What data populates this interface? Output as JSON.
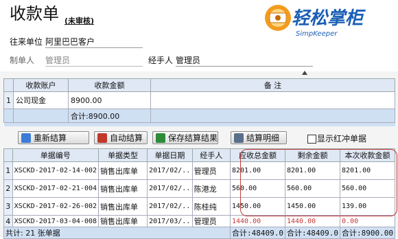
{
  "title": "收款单",
  "status": "(未审核)",
  "brand": {
    "name": "轻松掌柜",
    "sub": "SimpKeeper"
  },
  "form": {
    "partner_label": "往来单位",
    "partner_value": "阿里巴巴客户",
    "maker_label": "制单人",
    "maker_value": "管理员",
    "handler_label": "经手人",
    "handler_value": "管理员"
  },
  "account_table": {
    "headers": [
      "",
      "收款账户",
      "收款金额",
      "备 注"
    ],
    "rows": [
      {
        "idx": "1",
        "account": "公司现金",
        "amount": "8900.00",
        "note": ""
      }
    ],
    "total": "合计:8900.00"
  },
  "toolbar": {
    "recalc": "重新结算",
    "auto": "自动结算",
    "save": "保存结算结果",
    "detail": "结算明细",
    "red_label": "显示红冲单据"
  },
  "bill_table": {
    "headers": [
      "",
      "单据编号",
      "单据类型",
      "单据日期",
      "经手人",
      "应收总金额",
      "剩余金额",
      "本次收款金额"
    ],
    "rows": [
      {
        "idx": "1",
        "no": "XSCKD-2017-02-14-002",
        "type": "销售出库单",
        "date": "2017/02/..",
        "handler": "管理员",
        "total": "8201.00",
        "remain": "8201.00",
        "this": "8201.00"
      },
      {
        "idx": "2",
        "no": "XSCKD-2017-02-21-004",
        "type": "销售出库单",
        "date": "2017/02/..",
        "handler": "陈港龙",
        "total": "560.00",
        "remain": "560.00",
        "this": "560.00"
      },
      {
        "idx": "3",
        "no": "XSCKD-2017-02-26-002",
        "type": "销售出库单",
        "date": "2017/02/..",
        "handler": "陈桂纯",
        "total": "1450.00",
        "remain": "1450.00",
        "this": "139.00"
      },
      {
        "idx": "4",
        "no": "XSCKD-2017-03-04-008",
        "type": "销售出库单",
        "date": "2017/03/..",
        "handler": "管理员",
        "total": "1440.00",
        "remain": "1440.00",
        "this": "0.00"
      }
    ],
    "footer": {
      "count": "共计: 21 张单据",
      "total": "合计:48409.0",
      "remain": "合计:48409.0",
      "this": "合计:8900.00"
    }
  },
  "colors": {
    "highlight": "#c23a3a",
    "header_bg": "#dfe8f4",
    "total_bg": "#cfe0f3"
  }
}
